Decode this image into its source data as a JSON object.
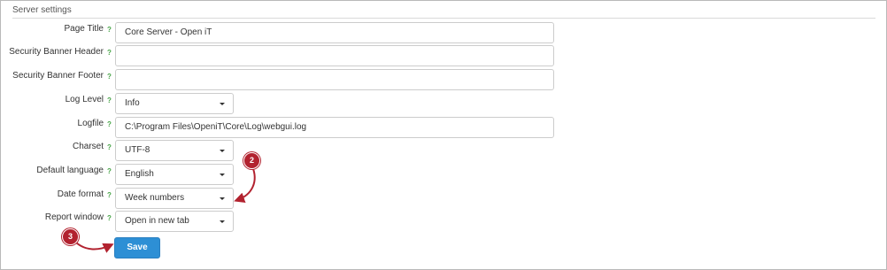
{
  "section": {
    "title": "Server settings"
  },
  "help_mark": "?",
  "fields": {
    "page_title": {
      "label": "Page Title",
      "value": "Core Server - Open iT"
    },
    "security_banner_header": {
      "label": "Security Banner Header",
      "value": ""
    },
    "security_banner_footer": {
      "label": "Security Banner Footer",
      "value": ""
    },
    "log_level": {
      "label": "Log Level",
      "value": "Info"
    },
    "logfile": {
      "label": "Logfile",
      "value": "C:\\Program Files\\OpeniT\\Core\\Log\\webgui.log"
    },
    "charset": {
      "label": "Charset",
      "value": "UTF-8"
    },
    "default_language": {
      "label": "Default language",
      "value": "English"
    },
    "date_format": {
      "label": "Date format",
      "value": "Week numbers"
    },
    "report_window": {
      "label": "Report window",
      "value": "Open in new tab"
    }
  },
  "save_label": "Save",
  "callouts": {
    "step2": "2",
    "step3": "3"
  },
  "colors": {
    "accent_blue": "#2d8fd5",
    "callout_red": "#b2222f",
    "help_green": "#47a447"
  }
}
